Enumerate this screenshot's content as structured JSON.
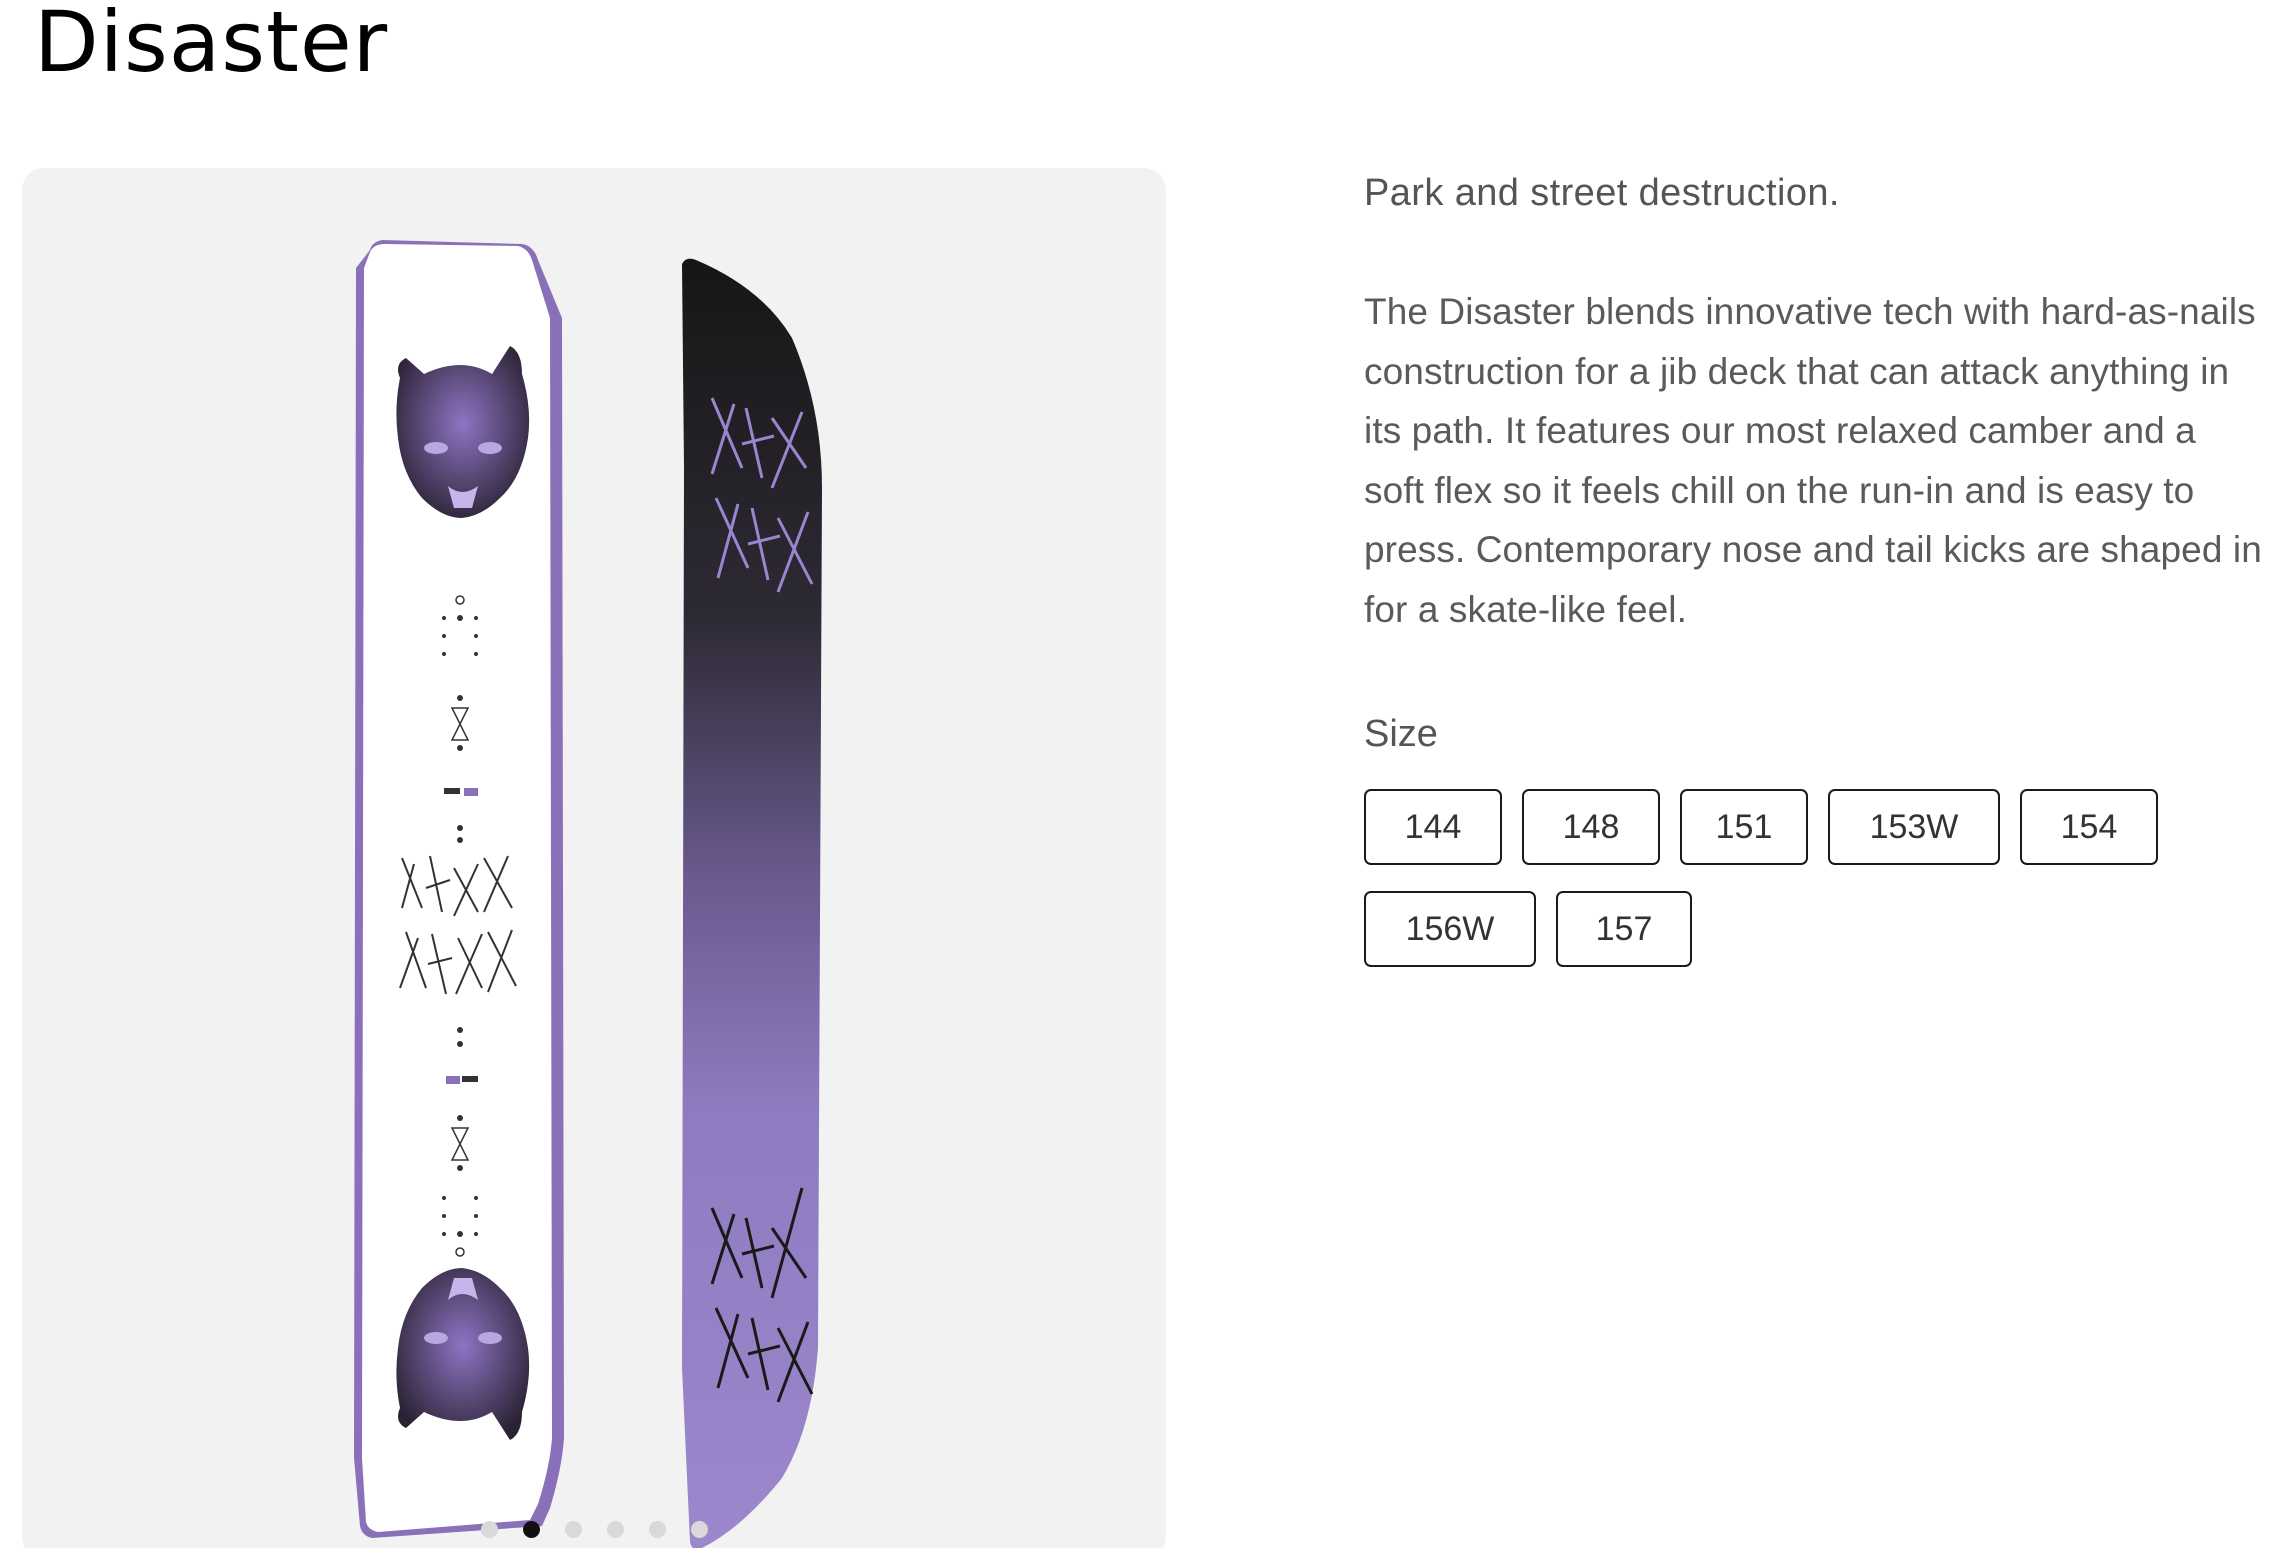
{
  "product": {
    "title": "Disaster",
    "tagline": "Park and street destruction.",
    "description": "The Disaster blends innovative tech with hard-as-nails construction for a jib deck that can attack anything in its path. It features our most relaxed camber and a soft flex so it feels chill on the run-in and is easy to press. Contemporary nose and tail kicks are shaped in for a skate-like feel.",
    "size_label": "Size",
    "sizes": [
      "144",
      "148",
      "151",
      "153W",
      "154",
      "156W",
      "157"
    ]
  },
  "gallery": {
    "slide_count": 6,
    "active_slide": 2
  },
  "colors": {
    "gallery_bg": "#f2f2f2",
    "board_purple": "#9b84c8",
    "board_dark": "#1a1a1a",
    "text_gray": "#555555"
  }
}
